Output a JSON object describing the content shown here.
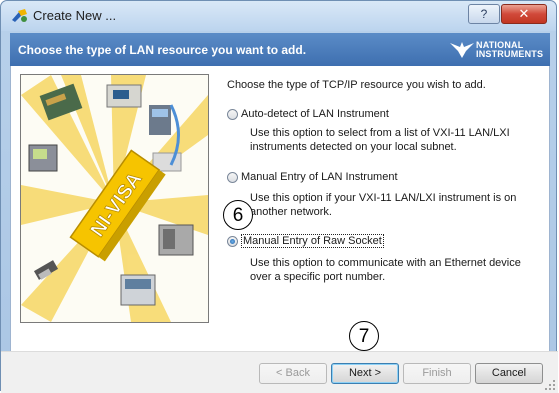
{
  "window": {
    "title": "Create New ...",
    "help_glyph": "?",
    "close_glyph": "✕"
  },
  "header": {
    "text": "Choose the type of LAN resource you want to add.",
    "logo_line1": "NATIONAL",
    "logo_line2": "INSTRUMENTS"
  },
  "illustration": {
    "banner_text": "NI-VISA",
    "colors": {
      "banner": "#f6c400",
      "ray": "#f7d764",
      "background": "#fdfcf4"
    }
  },
  "content": {
    "prompt": "Choose the type of TCP/IP resource you wish to add.",
    "options": [
      {
        "label": "Auto-detect of LAN Instrument",
        "selected": false,
        "description": "Use this option to select from a list of VXI-11 LAN/LXI instruments detected on your local subnet."
      },
      {
        "label": "Manual Entry of LAN Instrument",
        "selected": false,
        "description": "Use this option if your VXI-11 LAN/LXI instrument is on another network."
      },
      {
        "label": "Manual Entry of Raw Socket",
        "selected": true,
        "description": "Use this option to communicate with an Ethernet device over a specific port number."
      }
    ]
  },
  "callouts": {
    "step6": "6",
    "step7": "7"
  },
  "buttons": {
    "back": "< Back",
    "next": "Next >",
    "finish": "Finish",
    "cancel": "Cancel"
  }
}
